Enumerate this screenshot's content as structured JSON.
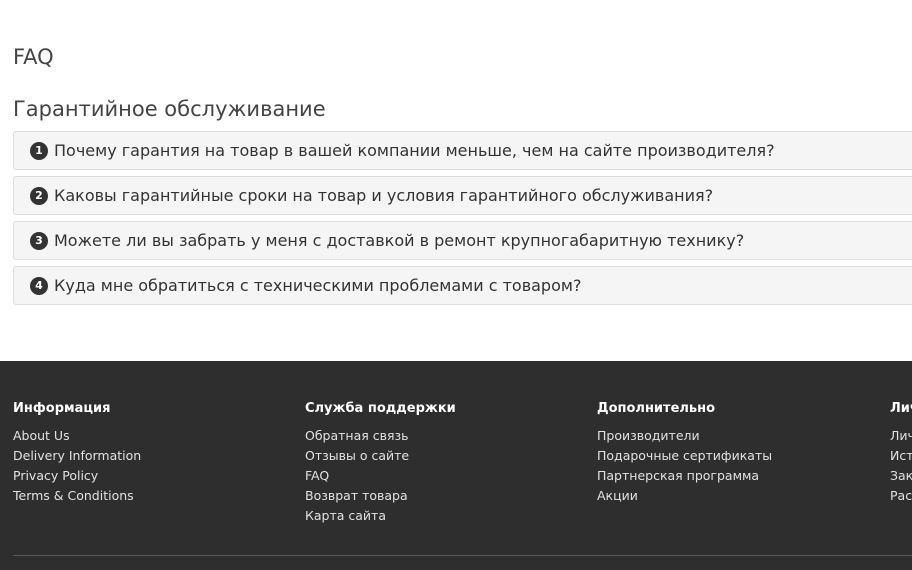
{
  "page": {
    "title": "FAQ",
    "section_title": "Гарантийное обслуживание"
  },
  "faq": [
    {
      "num": "1",
      "question": "Почему гарантия на товар в вашей компании меньше, чем на сайте производителя?"
    },
    {
      "num": "2",
      "question": "Каковы гарантийные сроки на товар и условия гарантийного обслуживания?"
    },
    {
      "num": "3",
      "question": "Можете ли вы забрать у меня с доставкой в ремонт крупногабаритную технику?"
    },
    {
      "num": "4",
      "question": "Куда мне обратиться с техническими проблемами с товаром?"
    }
  ],
  "footer": {
    "columns": [
      {
        "heading": "Информация",
        "links": [
          "About Us",
          "Delivery Information",
          "Privacy Policy",
          "Terms & Conditions"
        ]
      },
      {
        "heading": "Служба поддержки",
        "links": [
          "Обратная связь",
          "Отзывы о сайте",
          "FAQ",
          "Возврат товара",
          "Карта сайта"
        ]
      },
      {
        "heading": "Дополнительно",
        "links": [
          "Производители",
          "Подарочные сертификаты",
          "Партнерская программа",
          "Акции"
        ]
      },
      {
        "heading": "Лич",
        "links": [
          "Лич",
          "Ист",
          "Зак",
          "Рас"
        ]
      }
    ]
  },
  "colors": {
    "footer_bg": "#2e2e2e",
    "faq_bg": "#f5f5f5",
    "number_badge": "#333333"
  }
}
